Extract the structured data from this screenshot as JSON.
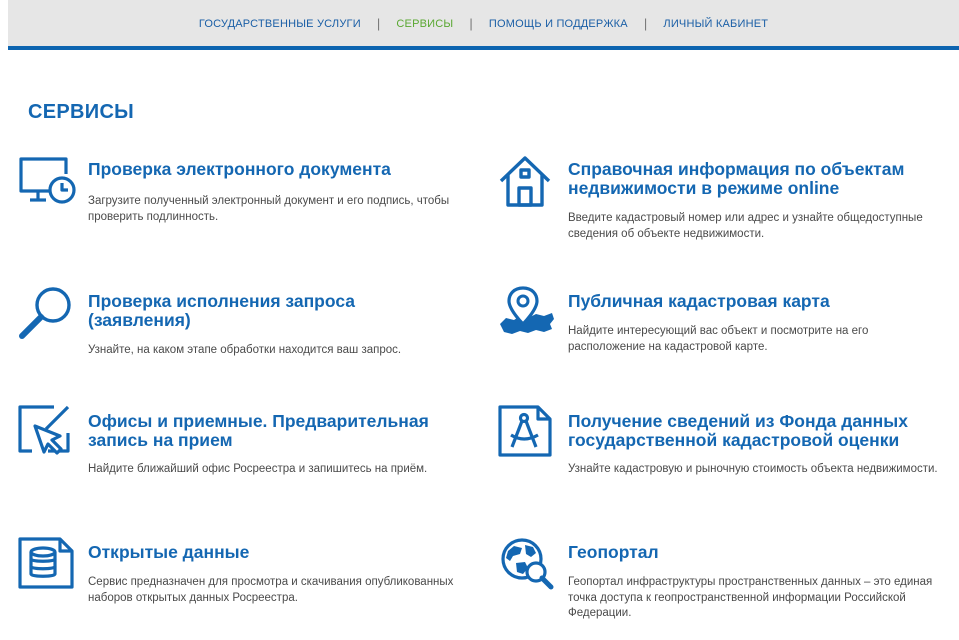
{
  "nav": {
    "items": [
      {
        "label": "ГОСУДАРСТВЕННЫЕ УСЛУГИ",
        "active": false
      },
      {
        "label": "СЕРВИСЫ",
        "active": true
      },
      {
        "label": "ПОМОЩЬ И ПОДДЕРЖКА",
        "active": false
      },
      {
        "label": "ЛИЧНЫЙ КАБИНЕТ",
        "active": false
      }
    ]
  },
  "page_title": "СЕРВИСЫ",
  "services": [
    {
      "icon": "monitor-clock-icon",
      "title": "Проверка электронного документа",
      "description": "Загрузите полученный электронный документ и его подпись, чтобы проверить подлинность."
    },
    {
      "icon": "house-icon",
      "title": "Справочная информация по объектам недвижимости в режиме online",
      "description": "Введите кадастровый номер или адрес и узнайте общедоступные сведения об объекте недвижимости."
    },
    {
      "icon": "magnifier-icon",
      "title": "Проверка исполнения запроса (заявления)",
      "description": "Узнайте, на каком этапе обработки находится ваш запрос."
    },
    {
      "icon": "map-pin-icon",
      "title": "Публичная кадастровая карта",
      "description": "Найдите интересующий вас объект и посмотрите на его расположение на кадастровой карте."
    },
    {
      "icon": "cursor-arrow-icon",
      "title": "Офисы и приемные. Предварительная запись на прием",
      "description": "Найдите ближайший офис Росреестра и запишитесь на приём."
    },
    {
      "icon": "compass-document-icon",
      "title": "Получение сведений из Фонда данных государственной кадастровой оценки",
      "description": "Узнайте кадастровую и рыночную стоимость объекта недвижимости."
    },
    {
      "icon": "database-document-icon",
      "title": "Открытые данные",
      "description": "Сервис предназначен для просмотра и скачивания опубликованных наборов открытых данных Росреестра."
    },
    {
      "icon": "globe-magnifier-icon",
      "title": "Геопортал",
      "description": "Геопортал инфраструктуры пространственных данных – это единая точка доступа к геопространственной информации Российской Федерации."
    }
  ],
  "colors": {
    "accent": "#1467b2",
    "active_nav": "#5aa832",
    "nav_bg": "#e6e6e6",
    "text": "#4a4a4a"
  }
}
